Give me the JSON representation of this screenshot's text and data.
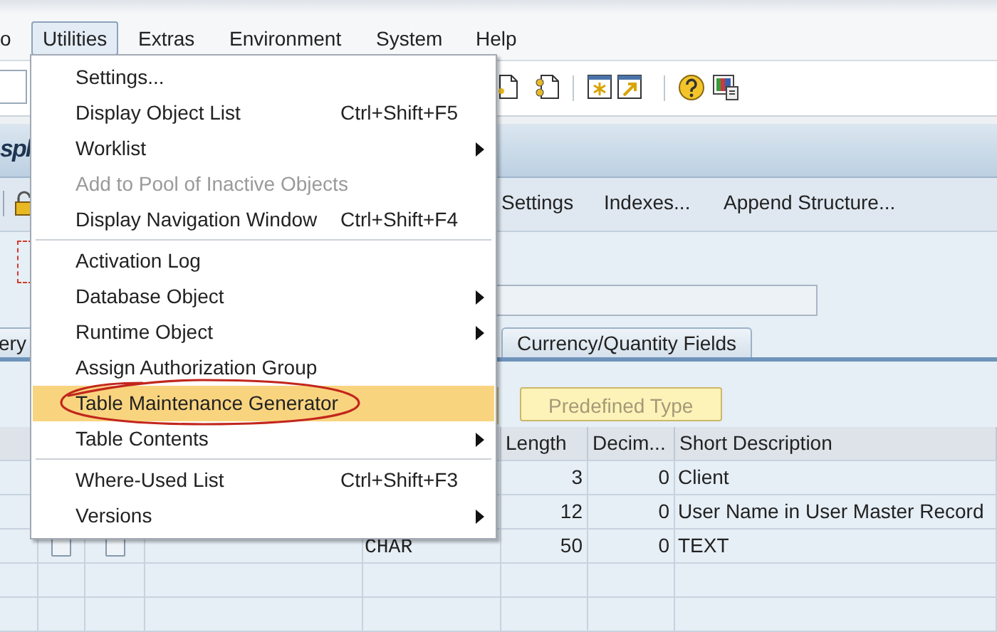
{
  "menu_bar": [
    {
      "label": "o",
      "selected": false
    },
    {
      "label": "Utilities",
      "selected": true
    },
    {
      "label": "Extras",
      "selected": false
    },
    {
      "label": "Environment",
      "selected": false
    },
    {
      "label": "System",
      "selected": false
    },
    {
      "label": "Help",
      "selected": false
    }
  ],
  "title": "spl",
  "app_toolbar": [
    "Settings",
    "Indexes...",
    "Append Structure..."
  ],
  "tabs": [
    {
      "label": "ery",
      "selected": false
    },
    {
      "label": "Currency/Quantity Fields",
      "selected": false
    }
  ],
  "buttons": [
    {
      "label": "Predefined Type",
      "disabled": true
    }
  ],
  "table": {
    "columns": [
      "Length",
      "Decim...",
      "Short Description"
    ],
    "rows": [
      {
        "length": "3",
        "decimals": "0",
        "short_description": "Client"
      },
      {
        "length": "12",
        "decimals": "0",
        "short_description": "User Name in User Master Record"
      },
      {
        "check_1": false,
        "check_2": false,
        "column_4": "CHAR",
        "length": "50",
        "decimals": "0",
        "short_description": "TEXT"
      }
    ]
  },
  "menu": [
    {
      "kind": "item",
      "label": "Settings...",
      "disabled": false,
      "selected": false
    },
    {
      "kind": "item",
      "label": "Display Object List",
      "shortcut": "Ctrl+Shift+F5",
      "disabled": false,
      "selected": false
    },
    {
      "kind": "item",
      "label": "Worklist",
      "submenu": true,
      "disabled": false,
      "selected": false
    },
    {
      "kind": "item",
      "label": "Add to Pool of Inactive Objects",
      "disabled": true,
      "selected": false
    },
    {
      "kind": "item",
      "label": "Display Navigation Window",
      "shortcut": "Ctrl+Shift+F4",
      "disabled": false,
      "selected": false
    },
    {
      "kind": "separator"
    },
    {
      "kind": "item",
      "label": "Activation Log",
      "disabled": false,
      "selected": false
    },
    {
      "kind": "item",
      "label": "Database Object",
      "submenu": true,
      "disabled": false,
      "selected": false
    },
    {
      "kind": "item",
      "label": "Runtime Object",
      "submenu": true,
      "disabled": false,
      "selected": false
    },
    {
      "kind": "item",
      "label": "Assign Authorization Group",
      "disabled": false,
      "selected": false
    },
    {
      "kind": "item",
      "label": "Table Maintenance Generator",
      "disabled": false,
      "selected": true
    },
    {
      "kind": "item",
      "label": "Table Contents",
      "submenu": true,
      "disabled": false,
      "selected": false
    },
    {
      "kind": "separator"
    },
    {
      "kind": "item",
      "label": "Where-Used List",
      "shortcut": "Ctrl+Shift+F3",
      "disabled": false,
      "selected": false
    },
    {
      "kind": "item",
      "label": "Versions",
      "submenu": true,
      "disabled": false,
      "selected": false
    }
  ]
}
